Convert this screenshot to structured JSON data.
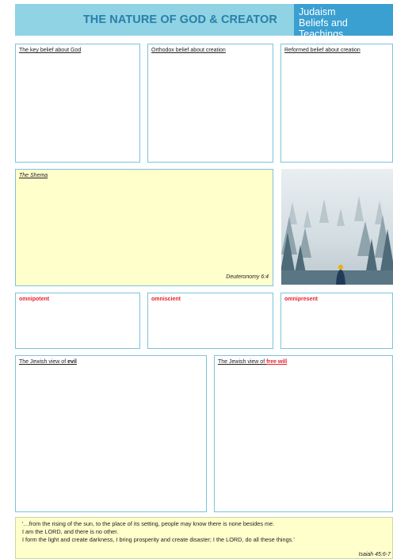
{
  "header": {
    "title": "THE NATURE OF GOD & CREATOR",
    "topic_line1": "Judaism",
    "topic_line2": "Beliefs and Teachings",
    "colors": {
      "band": "#8fd3e4",
      "title": "#2a7fa8",
      "topic_bg": "#3a9fd1"
    }
  },
  "row1": {
    "box1_label": "The key belief about God",
    "box2_label": "Orthodox belief about creation",
    "box3_label": "Reformed belief about creation"
  },
  "shema": {
    "label": "The Shema",
    "reference": "Deuteronomy 6:4"
  },
  "attributes": {
    "a1": "omnipotent",
    "a2": "omniscient",
    "a3": "omnipresent",
    "color": "#e8222c"
  },
  "views": {
    "evil_prefix": "The Jewish view of ",
    "evil_word": "evil",
    "freewill_prefix": "The Jewish view of ",
    "freewill_word": "free will"
  },
  "quote": {
    "line1": "'…from the rising of the sun, to the place of its setting, people may know there is none besides me.",
    "line2": "I am the LORD, and there is no other.",
    "line3": "I form the light and create darkness, I bring prosperity and create disaster; I the LORD, do all these things.'",
    "reference": "Isaiah 45:6-7"
  }
}
